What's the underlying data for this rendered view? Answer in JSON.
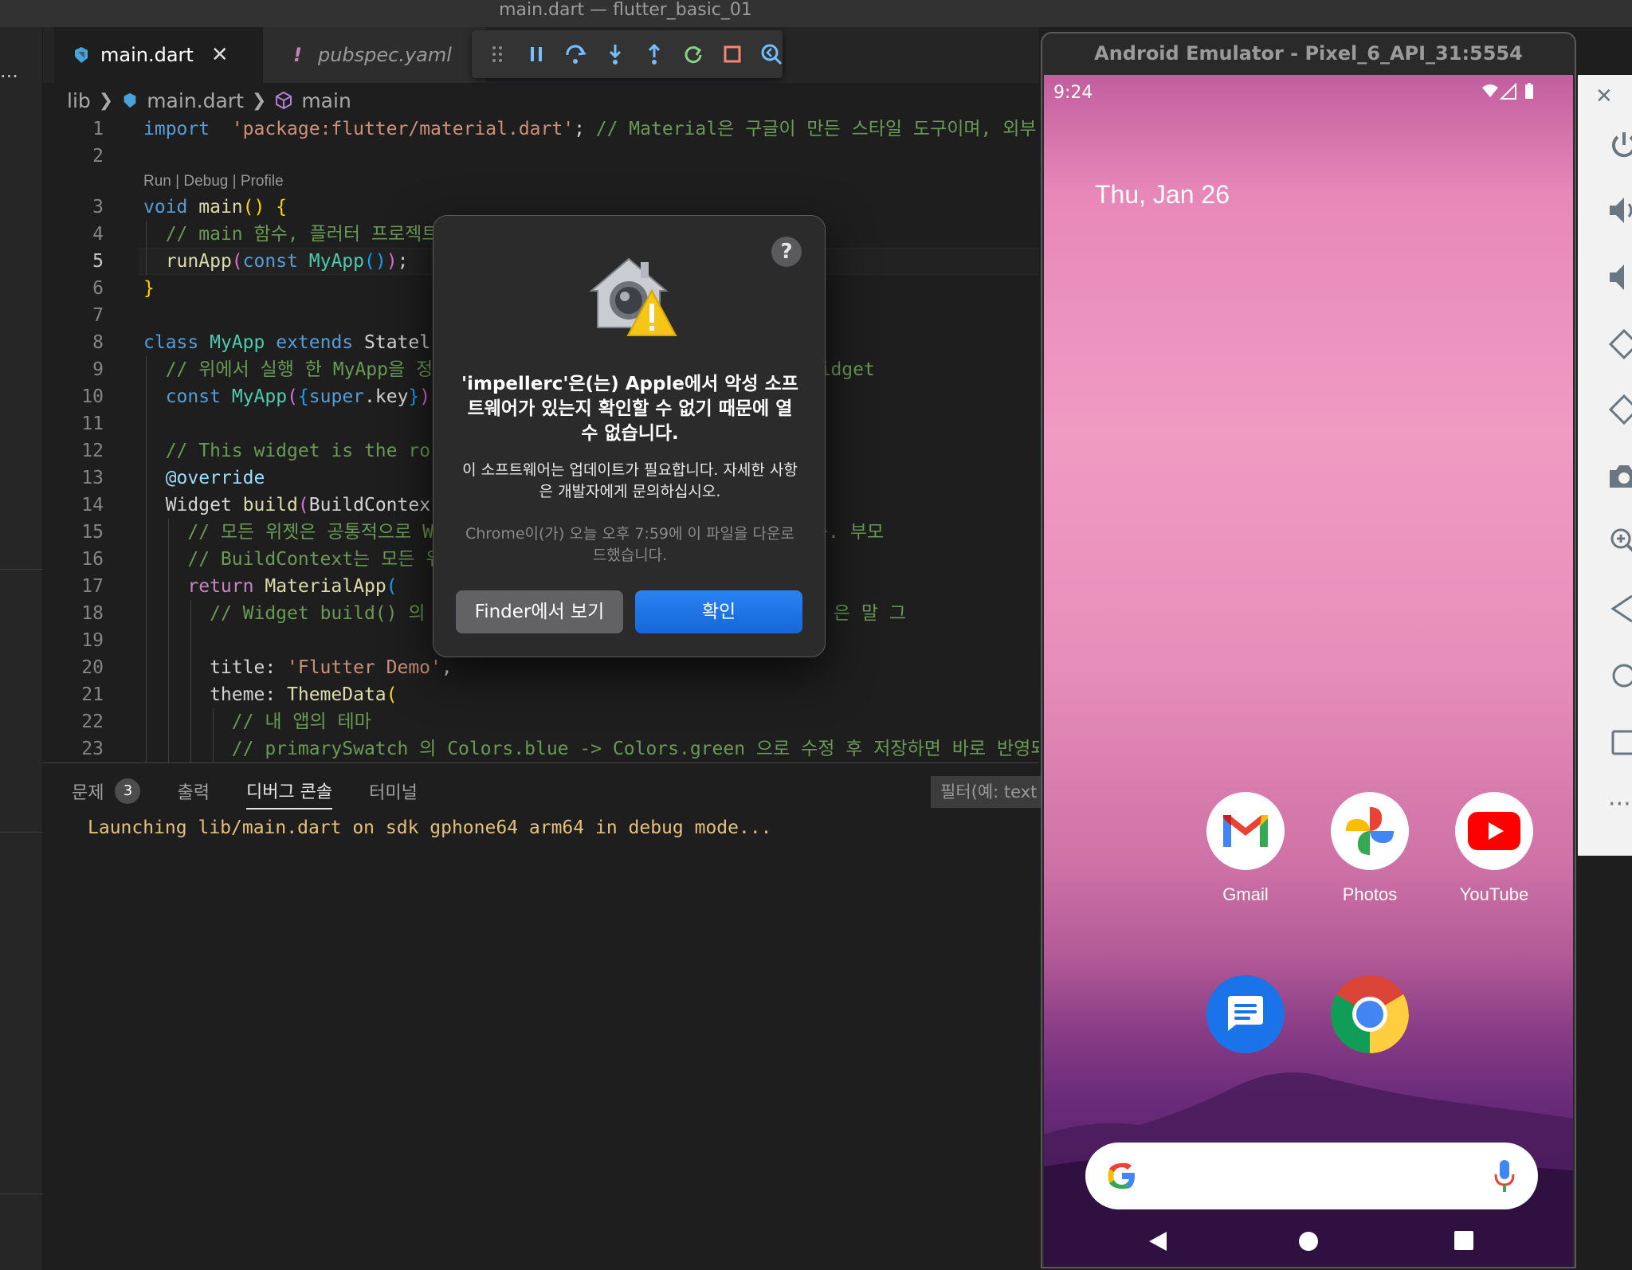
{
  "window": {
    "title": "main.dart — flutter_basic_01"
  },
  "activitybar": {
    "more": "···"
  },
  "tabs": [
    {
      "label": "main.dart",
      "close": "✕"
    },
    {
      "marker": "!",
      "label": "pubspec.yaml"
    }
  ],
  "debug_toolbar": {
    "icons": [
      "drag-handle-icon",
      "pause-icon",
      "step-over-icon",
      "step-into-icon",
      "step-out-icon",
      "restart-icon",
      "stop-icon",
      "flutter-inspector-icon"
    ],
    "colors": {
      "blue": "#75beff",
      "green": "#89d185",
      "red": "#f48771"
    }
  },
  "breadcrumb": {
    "folder": "lib",
    "file": "main.dart",
    "symbol": "main"
  },
  "editor": {
    "codelens": "Run | Debug | Profile",
    "current_line": "5",
    "lines": [
      {
        "n": "1",
        "parts": [
          [
            "kw",
            "import"
          ],
          [
            "",
            "  "
          ],
          [
            "str",
            "'package:flutter/material.dart'"
          ],
          [
            "",
            "; "
          ],
          [
            "com",
            "// Material은 구글이 만든 스타일 도구이며, 외부 패키"
          ]
        ]
      },
      {
        "n": "2",
        "parts": []
      },
      {
        "n": "3",
        "parts": [
          [
            "kw",
            "void"
          ],
          [
            "",
            " "
          ],
          [
            "fn",
            "main"
          ],
          [
            "br1",
            "()"
          ],
          [
            "",
            " "
          ],
          [
            "br1",
            "{"
          ]
        ]
      },
      {
        "n": "4",
        "parts": [
          [
            "",
            "  "
          ],
          [
            "com",
            "// main 함수, 플러터 프로젝트"
          ]
        ]
      },
      {
        "n": "5",
        "parts": [
          [
            "",
            "  "
          ],
          [
            "fn",
            "runApp"
          ],
          [
            "br2",
            "("
          ],
          [
            "kw",
            "const"
          ],
          [
            "",
            " "
          ],
          [
            "ty",
            "MyApp"
          ],
          [
            "br3",
            "()"
          ],
          [
            "br2",
            ")"
          ],
          [
            "",
            ";"
          ]
        ]
      },
      {
        "n": "6",
        "parts": [
          [
            "br1",
            "}"
          ]
        ]
      },
      {
        "n": "7",
        "parts": []
      },
      {
        "n": "8",
        "parts": [
          [
            "kw",
            "class"
          ],
          [
            "",
            " "
          ],
          [
            "ty",
            "MyApp"
          ],
          [
            "",
            " "
          ],
          [
            "kw",
            "extends"
          ],
          [
            "",
            " "
          ],
          [
            "",
            "Statel"
          ]
        ]
      },
      {
        "n": "9",
        "parts": [
          [
            "",
            "  "
          ],
          [
            "com",
            "// 위에서 실행 한 MyApp을 정의"
          ],
          [
            "",
            "                   "
          ],
          [
            "com",
            "젯(state less widget"
          ]
        ]
      },
      {
        "n": "10",
        "parts": [
          [
            "",
            "  "
          ],
          [
            "kw",
            "const"
          ],
          [
            "",
            " "
          ],
          [
            "ty",
            "MyApp"
          ],
          [
            "br2",
            "("
          ],
          [
            "br3",
            "{"
          ],
          [
            "kw",
            "super"
          ],
          [
            "",
            ".key"
          ],
          [
            "br3",
            "}"
          ],
          [
            "br2",
            ")"
          ]
        ]
      },
      {
        "n": "11",
        "parts": []
      },
      {
        "n": "12",
        "parts": [
          [
            "",
            "  "
          ],
          [
            "com",
            "// This widget is the ro"
          ]
        ]
      },
      {
        "n": "13",
        "parts": [
          [
            "",
            "  "
          ],
          [
            "var",
            "@override"
          ]
        ]
      },
      {
        "n": "14",
        "parts": [
          [
            "",
            "  "
          ],
          [
            "",
            "Widget "
          ],
          [
            "fn",
            "build"
          ],
          [
            "br2",
            "("
          ],
          [
            "",
            "BuildContex"
          ]
        ]
      },
      {
        "n": "15",
        "parts": [
          [
            "",
            "    "
          ],
          [
            "com",
            "// 모든 위젯은 공통적으로 Wi"
          ],
          [
            "",
            "                   "
          ],
          [
            "com",
            "메서드를 가지고 있음. 부모"
          ]
        ]
      },
      {
        "n": "16",
        "parts": [
          [
            "",
            "    "
          ],
          [
            "com",
            "// BuildContext는 모든 위"
          ]
        ]
      },
      {
        "n": "17",
        "parts": [
          [
            "",
            "    "
          ],
          [
            "kw2",
            "return"
          ],
          [
            "",
            " "
          ],
          [
            "fn",
            "MaterialApp"
          ],
          [
            "br3",
            "("
          ]
        ]
      },
      {
        "n": "18",
        "parts": [
          [
            "",
            "      "
          ],
          [
            "com",
            "// Widget build() 의"
          ],
          [
            "",
            "                       "
          ],
          [
            "com",
            ". MaterialApp 은 말 그"
          ]
        ]
      },
      {
        "n": "19",
        "parts": []
      },
      {
        "n": "20",
        "parts": [
          [
            "",
            "      title: "
          ],
          [
            "str",
            "'Flutter Demo'"
          ],
          [
            "",
            ","
          ]
        ]
      },
      {
        "n": "21",
        "parts": [
          [
            "",
            "      theme: "
          ],
          [
            "fn",
            "ThemeData"
          ],
          [
            "br1",
            "("
          ]
        ]
      },
      {
        "n": "22",
        "parts": [
          [
            "",
            "        "
          ],
          [
            "com",
            "// 내 앱의 테마"
          ]
        ]
      },
      {
        "n": "23",
        "parts": [
          [
            "",
            "        "
          ],
          [
            "com",
            "// primarySwatch 의 Colors.blue -> Colors.green 으로 수정 후 저장하면 바로 반영되는"
          ]
        ]
      }
    ]
  },
  "panel": {
    "tabs": [
      {
        "label": "문제",
        "badge": "3"
      },
      {
        "label": "출력"
      },
      {
        "label": "디버그 콘솔"
      },
      {
        "label": "터미널"
      }
    ],
    "filter_placeholder": "필터(예: text",
    "console_line": "Launching lib/main.dart on sdk gphone64 arm64 in debug mode..."
  },
  "dialog": {
    "help": "?",
    "title": "'impellerc'은(는) Apple에서 악성 소프트웨어가 있는지 확인할 수 없기 때문에 열 수 없습니다.",
    "body": "이 소프트웨어는 업데이트가 필요합니다. 자세한 사항은 개발자에게 문의하십시오.",
    "source": "Chrome이(가) 오늘 오후 7:59에 이 파일을 다운로드했습니다.",
    "btn_finder": "Finder에서 보기",
    "btn_ok": "확인",
    "accent": "#1a73e8"
  },
  "emulator": {
    "title": "Android Emulator - Pixel_6_API_31:5554",
    "time": "9:24",
    "date": "Thu, Jan 26",
    "apps": [
      {
        "label": "Gmail",
        "icon": "gmail-icon"
      },
      {
        "label": "Photos",
        "icon": "photos-icon"
      },
      {
        "label": "YouTube",
        "icon": "youtube-icon"
      },
      {
        "label": "",
        "icon": "messages-icon"
      },
      {
        "label": "",
        "icon": "chrome-icon"
      }
    ],
    "side_close": "✕",
    "side_more": "···"
  }
}
